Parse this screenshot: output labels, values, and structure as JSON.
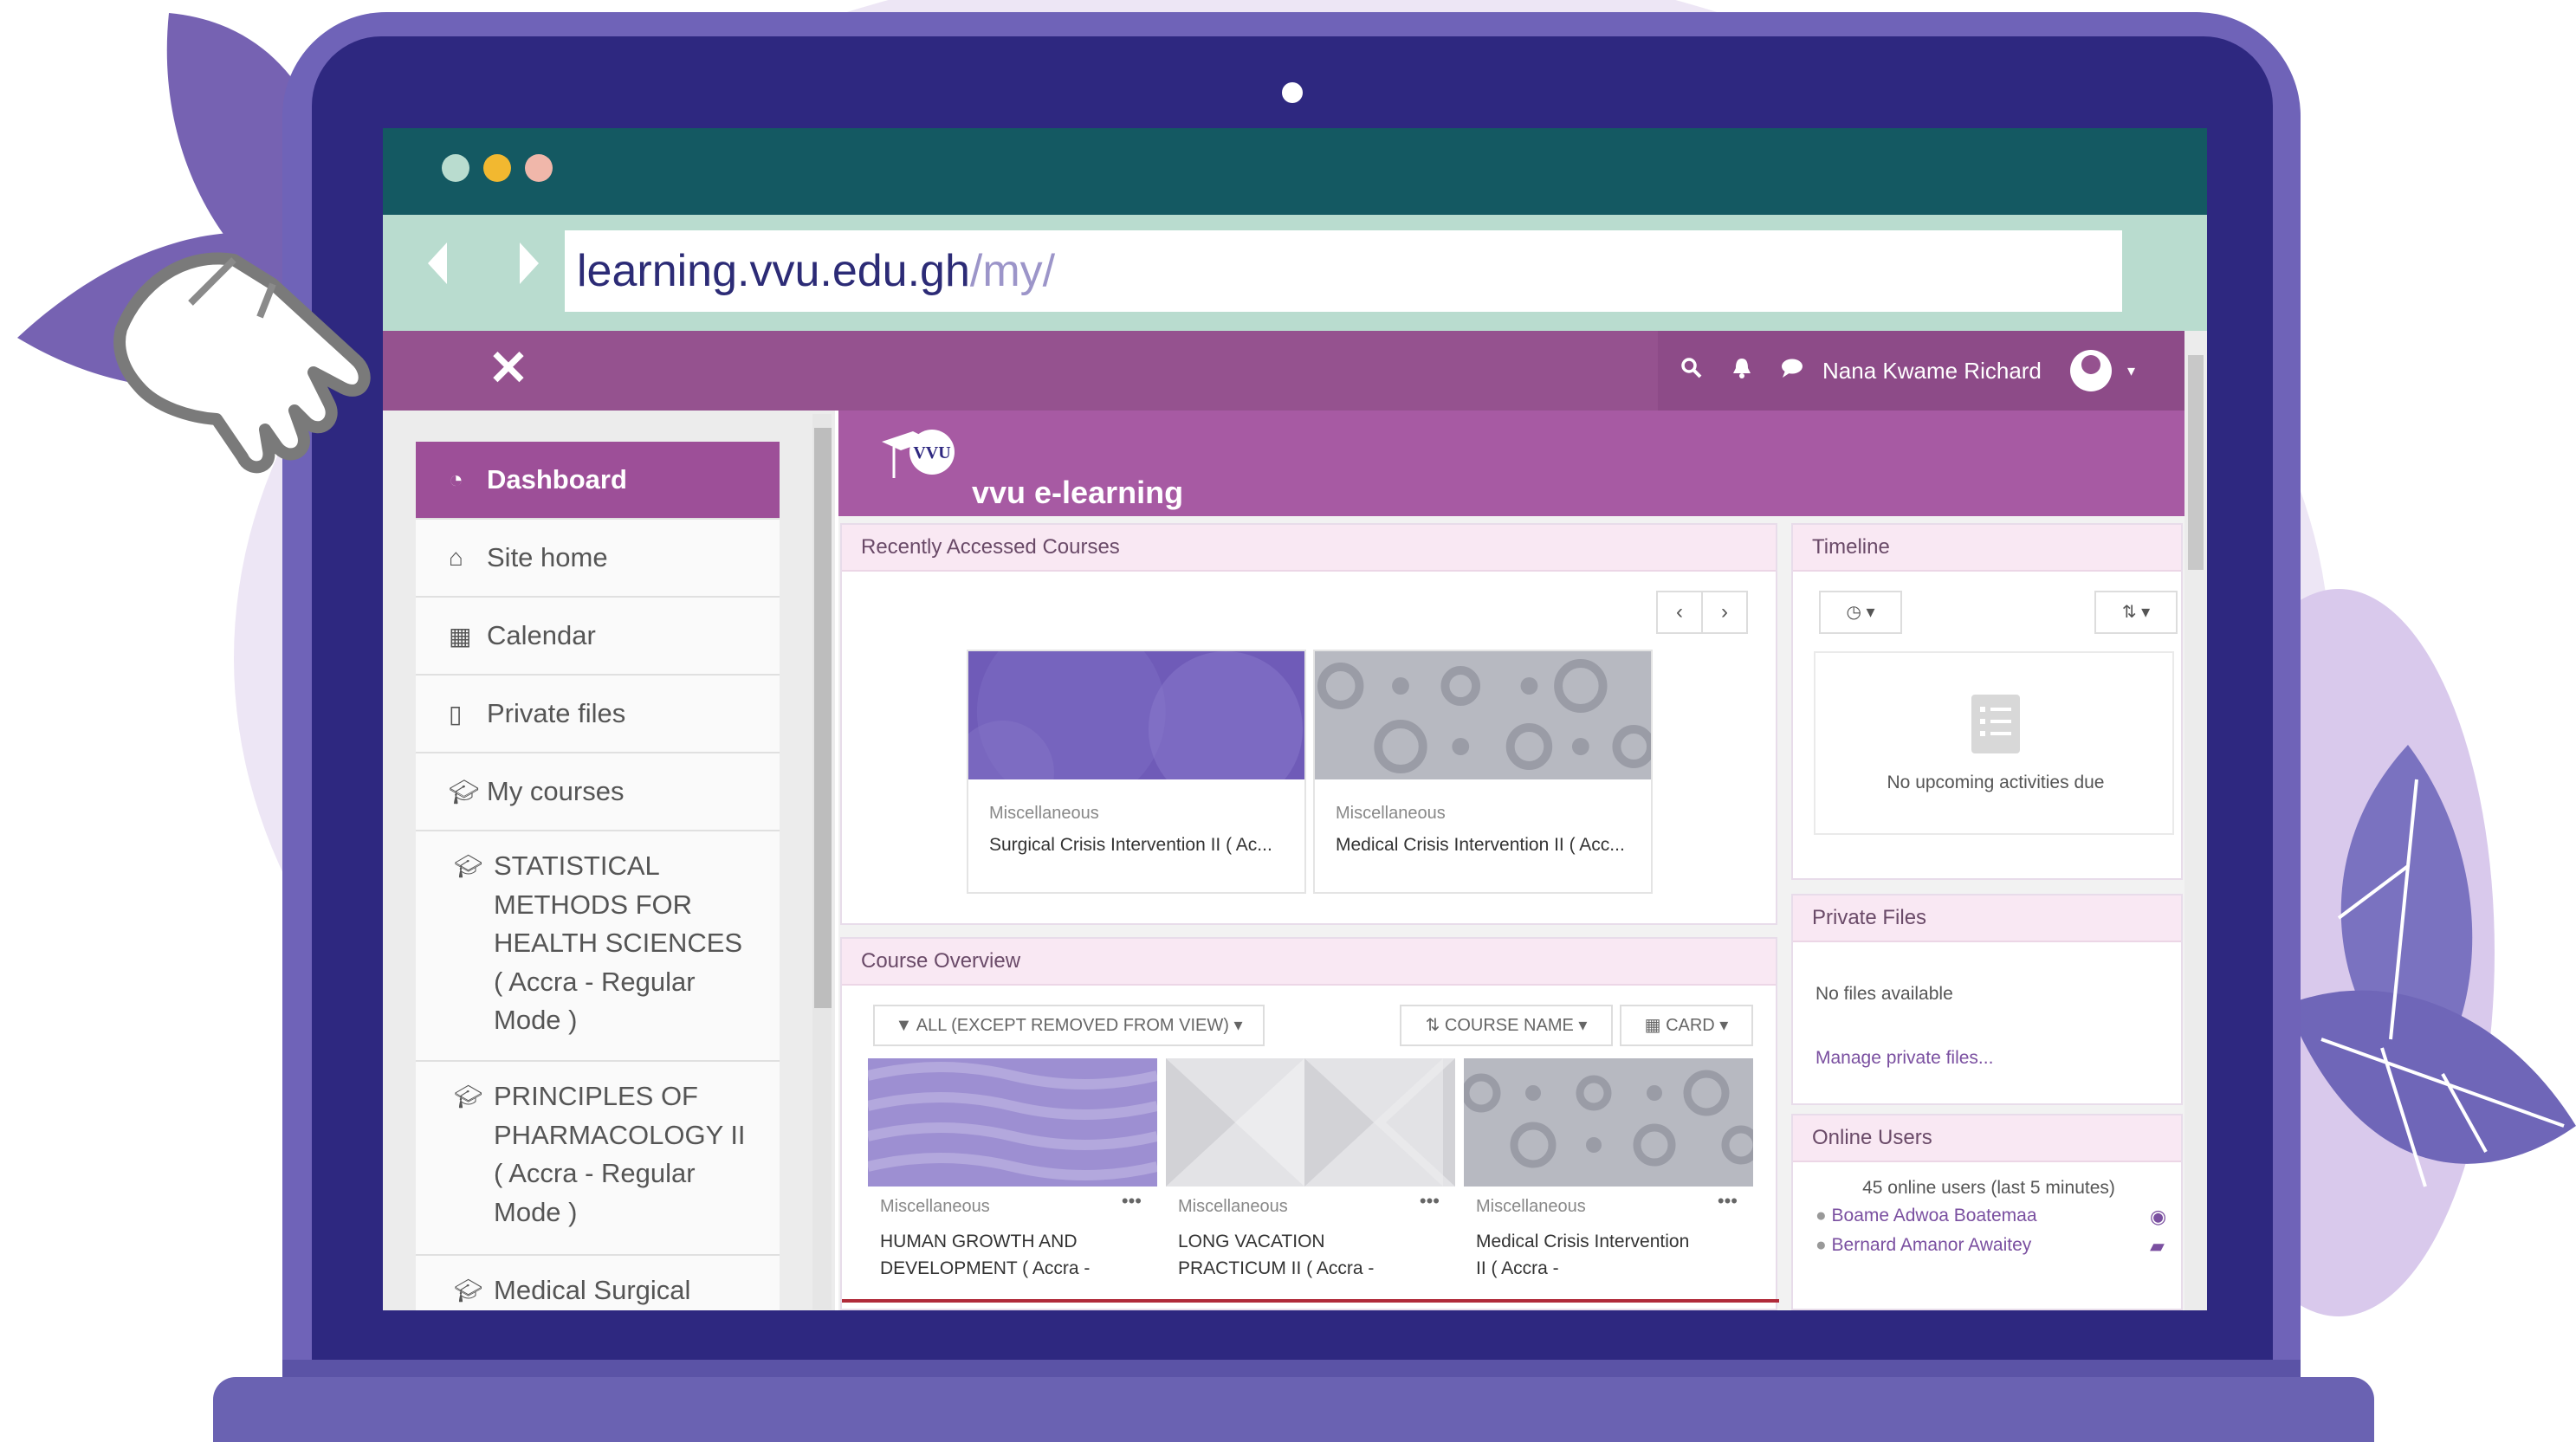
{
  "browser": {
    "url_domain": "learning.vvu.edu.gh",
    "url_path": "/my/",
    "traffic_lights": [
      "#b9dccf",
      "#f2b830",
      "#f0b7aa"
    ]
  },
  "topnav": {
    "close_icon": "close-icon",
    "user_name": "Nana Kwame Richard",
    "icons": [
      "search-icon",
      "bell-icon",
      "chat-icon",
      "user-avatar-icon",
      "caret-down-icon"
    ]
  },
  "sidebar": {
    "items": [
      {
        "label": "Dashboard",
        "icon": "dashboard-icon",
        "active": true
      },
      {
        "label": "Site home",
        "icon": "home-icon"
      },
      {
        "label": "Calendar",
        "icon": "calendar-icon"
      },
      {
        "label": "Private files",
        "icon": "file-icon"
      },
      {
        "label": "My courses",
        "icon": "graduation-cap-icon"
      }
    ],
    "courses": [
      {
        "lines": [
          "STATISTICAL",
          "METHODS FOR",
          "HEALTH SCIENCES",
          "( Accra - Regular",
          "Mode )"
        ]
      },
      {
        "lines": [
          "PRINCIPLES OF",
          "PHARMACOLOGY II",
          "( Accra - Regular",
          "Mode )"
        ]
      },
      {
        "lines": [
          "Medical Surgical"
        ]
      }
    ]
  },
  "banner": {
    "logo_text": "VVU",
    "brand": "vvu e-learning"
  },
  "recent": {
    "title": "Recently Accessed Courses",
    "courses": [
      {
        "category": "Miscellaneous",
        "name": "Surgical Crisis Intervention II ( Ac..."
      },
      {
        "category": "Miscellaneous",
        "name": "Medical Crisis Intervention II ( Acc..."
      }
    ]
  },
  "overview": {
    "title": "Course Overview",
    "filter_label": "ALL (EXCEPT REMOVED FROM VIEW)",
    "sort_label": "COURSE NAME",
    "view_label": "CARD",
    "courses": [
      {
        "category": "Miscellaneous",
        "name_lines": [
          "HUMAN GROWTH AND",
          "DEVELOPMENT ( Accra -"
        ]
      },
      {
        "category": "Miscellaneous",
        "name_lines": [
          "LONG VACATION",
          "PRACTICUM II ( Accra -"
        ]
      },
      {
        "category": "Miscellaneous",
        "name_lines": [
          "Medical Crisis Intervention",
          "II ( Accra -"
        ]
      }
    ]
  },
  "timeline": {
    "title": "Timeline",
    "empty": "No upcoming activities due"
  },
  "private_files": {
    "title": "Private Files",
    "empty": "No files available",
    "manage": "Manage private files..."
  },
  "online_users": {
    "title": "Online Users",
    "summary": "45 online users (last 5 minutes)",
    "users": [
      "Boame Adwoa Boatemaa",
      "Bernard Amanor Awaitey"
    ]
  },
  "colors": {
    "primary": "#9d4f98",
    "banner": "#a75aa3",
    "laptop": "#6f63b8",
    "bezel": "#2e2880",
    "titlebar": "#145962"
  }
}
